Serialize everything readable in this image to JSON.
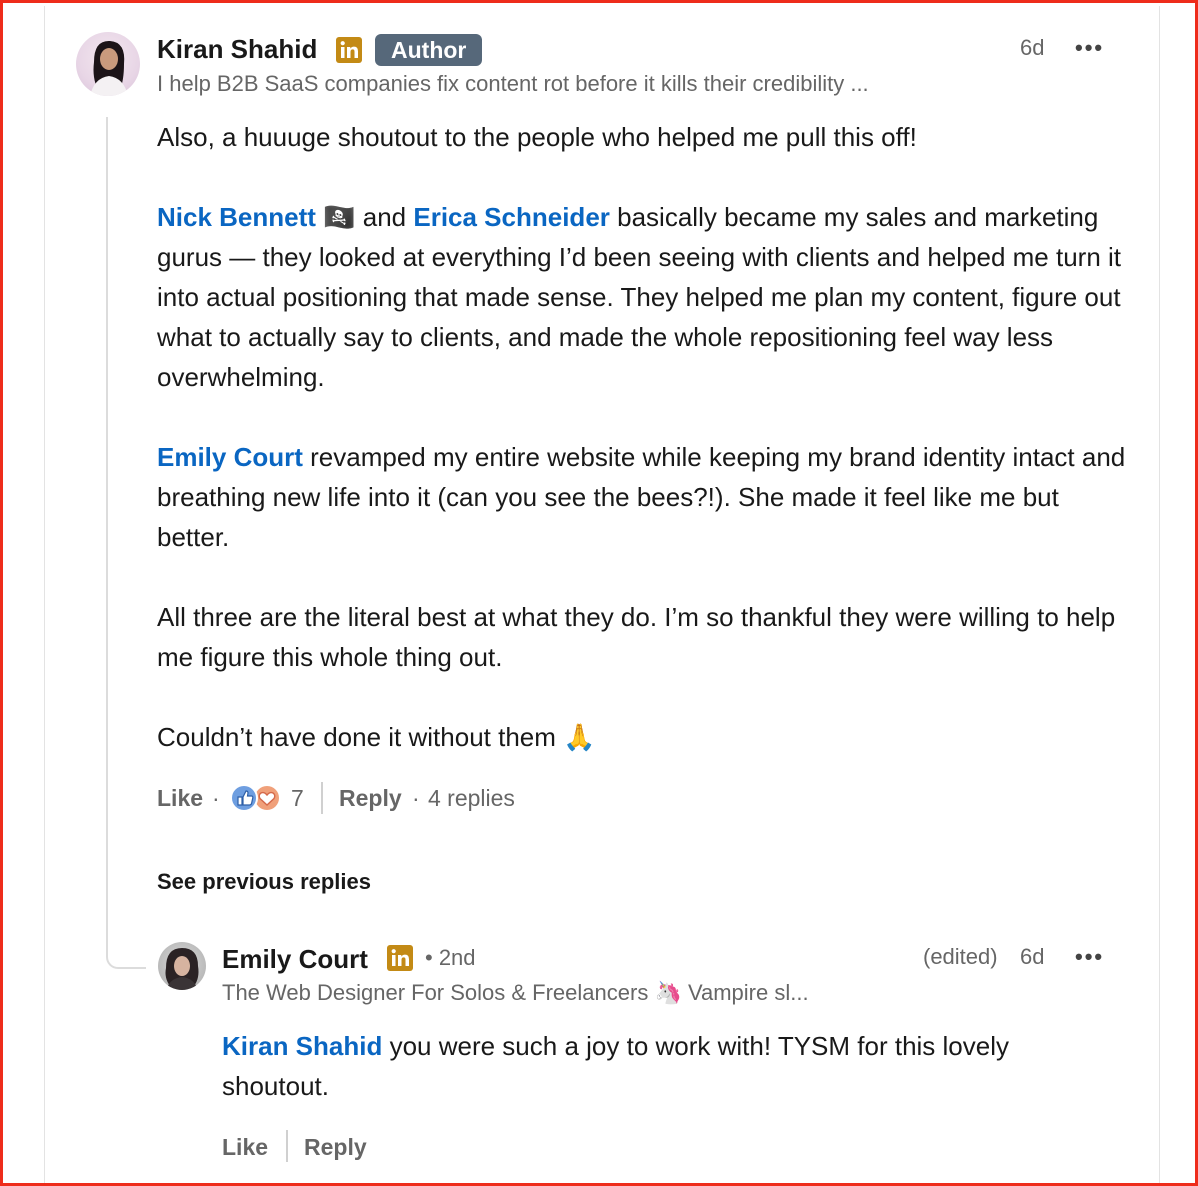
{
  "comment": {
    "author_name": "Kiran Shahid",
    "author_badge": "Author",
    "headline": "I help B2B SaaS companies fix content rot before it kills their credibility ...",
    "time": "6d",
    "more_label": "•••",
    "paragraphs": {
      "p1": "Also, a huuuge shoutout to the people who helped me pull this off!",
      "p2_mention1": "Nick Bennett",
      "p2_flag": "🏴‍☠️",
      "p2_and": " and ",
      "p2_mention2": "Erica Schneider",
      "p2_rest": " basically became my sales and marketing gurus — they looked at everything I’d been seeing with clients and helped me turn it into actual positioning that made sense. They helped me plan my content, figure out what to actually say to clients, and made the whole repositioning feel way less overwhelming.",
      "p3_mention": "Emily Court",
      "p3_rest": " revamped my entire website while keeping my brand identity intact and breathing new life into it (can you see the bees?!). She made it feel like me but better.",
      "p4": "All three are the literal best at what they do. I’m so thankful they were willing to help me figure this whole thing out.",
      "p5": "Couldn’t have done it without them 🙏"
    },
    "actions": {
      "like_label": "Like",
      "dot": "·",
      "reaction_count": "7",
      "reply_label": "Reply",
      "replies_count": "4 replies"
    }
  },
  "see_previous_label": "See previous replies",
  "reply": {
    "author_name": "Emily Court",
    "degree": "• 2nd",
    "edited": "(edited)",
    "time": "6d",
    "more_label": "•••",
    "headline": "The Web Designer For Solos & Freelancers 🦄 Vampire sl...",
    "mention": "Kiran Shahid",
    "text": " you were such a joy to work with! TYSM for this lovely shoutout.",
    "like_label": "Like",
    "reply_label": "Reply"
  },
  "colors": {
    "mention_blue": "#0a66c2",
    "linkedin_badge": "#c38a15",
    "author_badge_bg": "#56687a",
    "frame_red": "#ee2c1b"
  }
}
